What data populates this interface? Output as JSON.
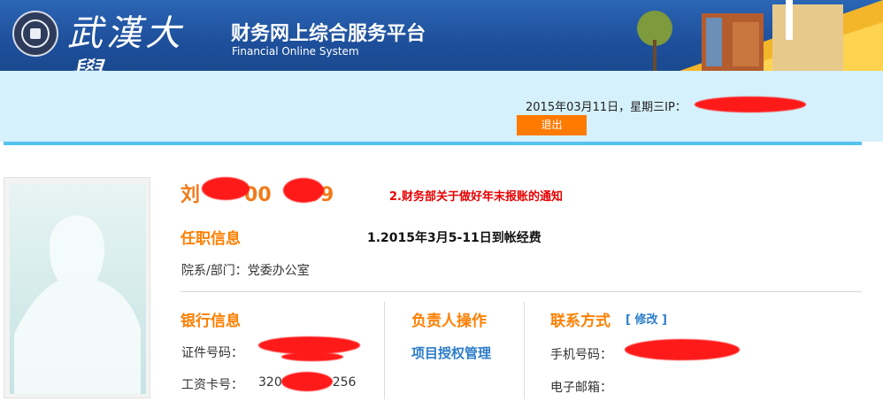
{
  "header": {
    "brand_cn": "武漢大學",
    "title_cn": "财务网上综合服务平台",
    "title_en": "Financial Online System"
  },
  "topbar": {
    "date_text": "2015年03月11日，星期三IP：",
    "logout_label": "退出"
  },
  "profile": {
    "name_prefix": "刘",
    "name_suffix": "09",
    "id_partial": "00",
    "notice_link": "2.财务部关于做好年末报账的通知",
    "employment_title": "任职信息",
    "funds_notice": "1.2015年3月5-11日到帐经费",
    "department_label": "院系/部门：",
    "department_value": "党委办公室"
  },
  "bank": {
    "title": "银行信息",
    "id_label": "证件号码：",
    "salary_label": "工资卡号：",
    "salary_prefix": "320",
    "salary_suffix": "256"
  },
  "operator": {
    "title": "负责人操作",
    "project_auth": "项目授权管理"
  },
  "contact": {
    "title": "联系方式",
    "edit_label": "[ 修改 ]",
    "phone_label": "手机号码：",
    "email_label": "电子邮箱："
  },
  "colors": {
    "header_blue": "#1e4f9b",
    "accent_orange": "#ff7f00",
    "link_blue": "#2d7dc9",
    "alert_red": "#e80000",
    "sky": "#d5f1fb"
  }
}
